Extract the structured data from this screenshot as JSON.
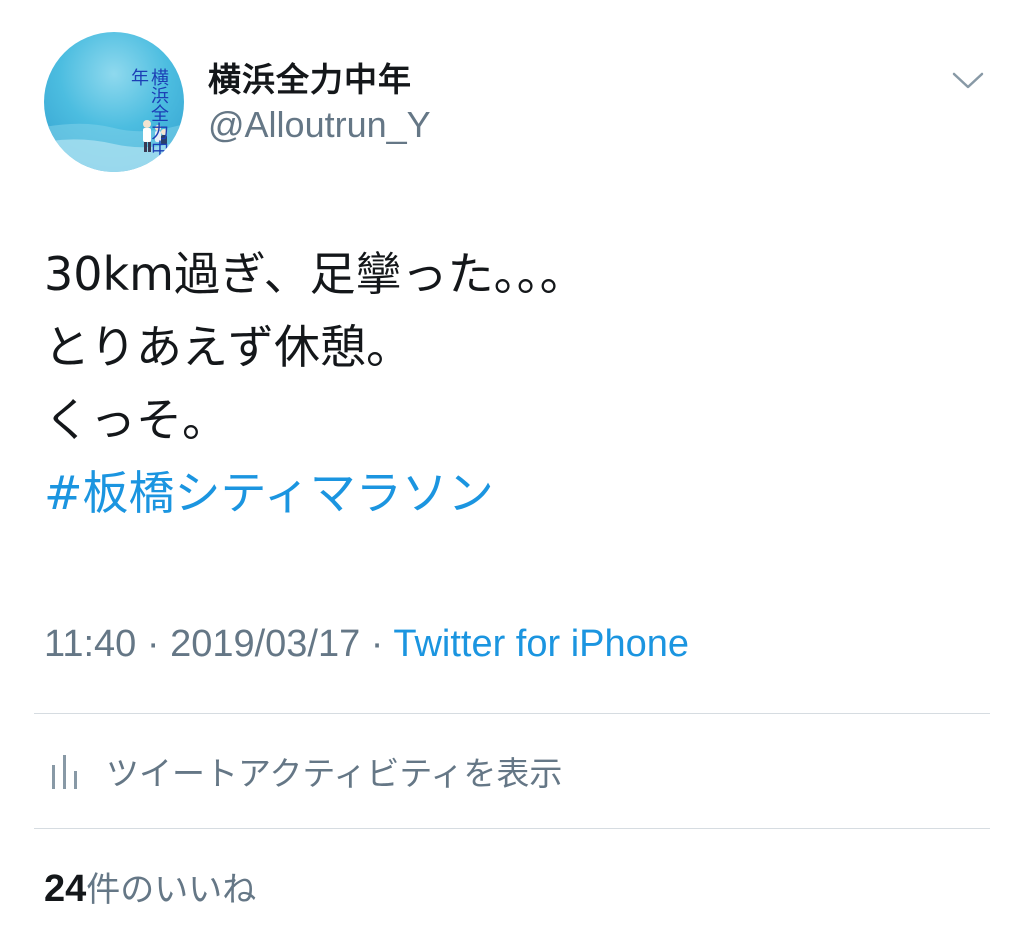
{
  "user": {
    "display_name": "横浜全力中年",
    "handle": "@Alloutrun_Y",
    "avatar_text": "横浜全力中年"
  },
  "tweet": {
    "lines": [
      "30km過ぎ、足攣った。。。",
      "とりあえず休憩。",
      "くっそ。"
    ],
    "hashtag": "#板橋シティマラソン"
  },
  "meta": {
    "time": "11:40",
    "date": "2019/03/17",
    "separator": " · ",
    "source": "Twitter for iPhone"
  },
  "activity": {
    "label": "ツイートアクティビティを表示",
    "icon": "bar-chart-icon"
  },
  "likes": {
    "count": "24",
    "label": "件のいいね"
  },
  "colors": {
    "link": "#1b95e0",
    "secondary_text": "#657786",
    "primary_text": "#14171a",
    "divider": "#d6dce1"
  }
}
